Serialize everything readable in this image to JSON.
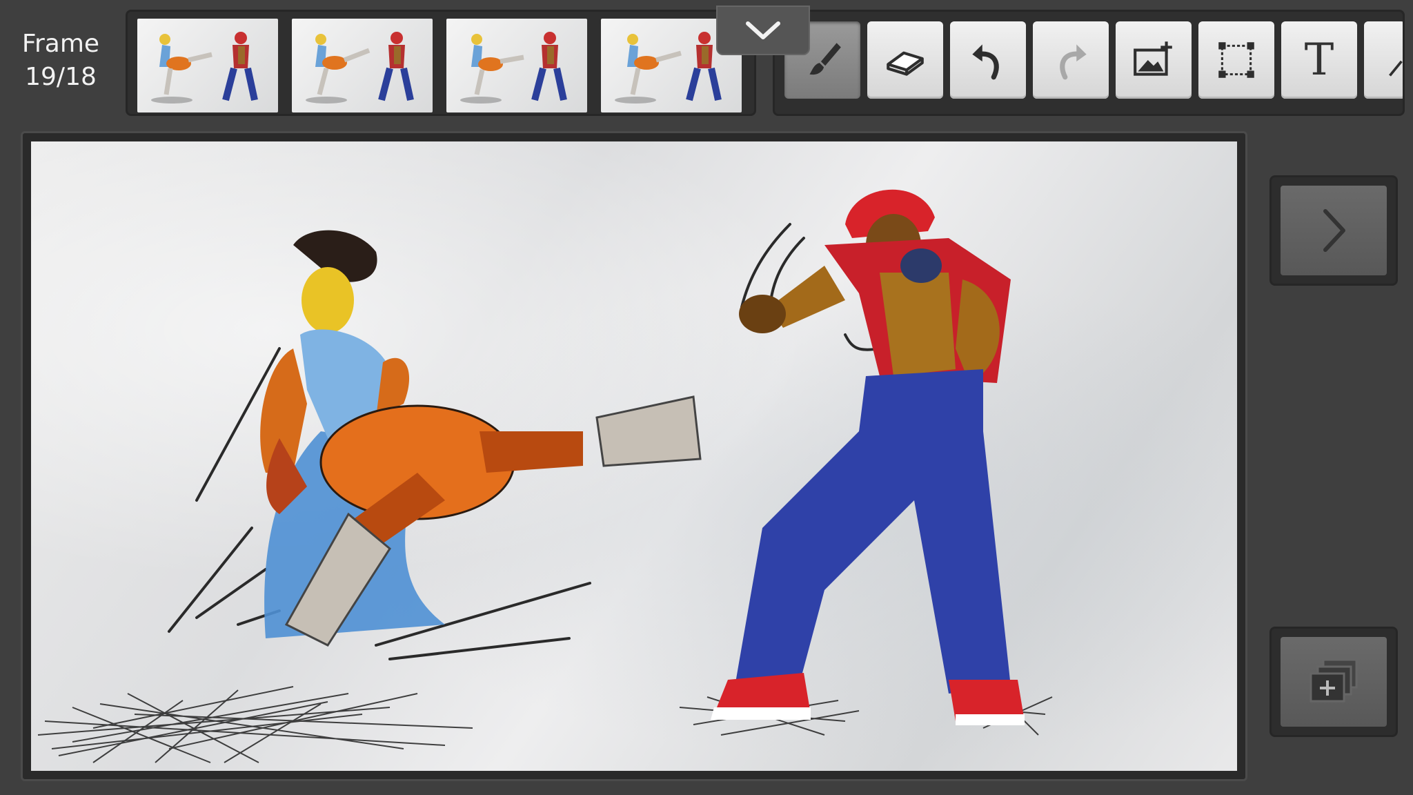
{
  "frame": {
    "label": "Frame",
    "position": "19/18"
  },
  "thumbnails": [
    {
      "name": "frame-thumbnail-1"
    },
    {
      "name": "frame-thumbnail-2"
    },
    {
      "name": "frame-thumbnail-3"
    },
    {
      "name": "frame-thumbnail-4"
    }
  ],
  "toolbar": {
    "tools": [
      {
        "id": "brush",
        "icon": "brush-icon",
        "active": true
      },
      {
        "id": "eraser",
        "icon": "eraser-icon",
        "active": false
      },
      {
        "id": "undo",
        "icon": "undo-icon",
        "active": false
      },
      {
        "id": "redo",
        "icon": "redo-icon",
        "active": false,
        "disabled": true
      },
      {
        "id": "add-image",
        "icon": "add-image-icon",
        "active": false
      },
      {
        "id": "select",
        "icon": "selection-icon",
        "active": false
      },
      {
        "id": "text",
        "icon": "text-icon",
        "label": "T",
        "active": false
      }
    ]
  },
  "colors": {
    "background": "#3f3f3f",
    "panel": "#2f2f2f",
    "button": "#e6e6e6",
    "active_button": "#8a8a8a"
  }
}
